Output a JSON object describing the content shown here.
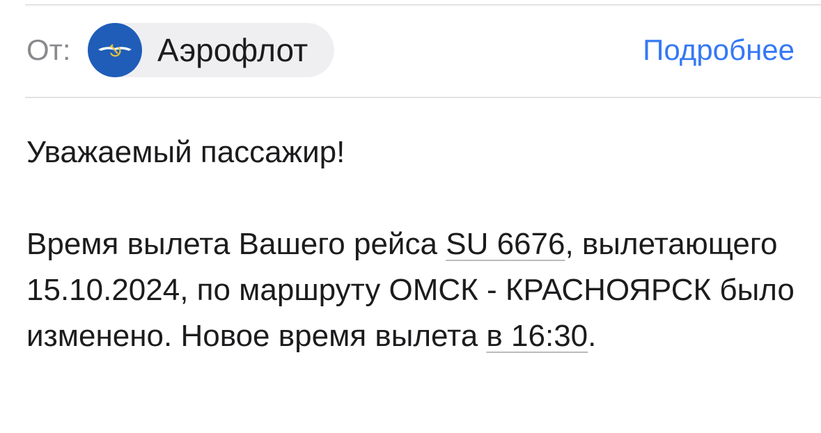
{
  "header": {
    "from_label": "От:",
    "sender": {
      "name": "Аэрофлот",
      "avatar_icon": "aeroflot-logo-icon",
      "avatar_color": "#1f5db8"
    },
    "details_link": "Подробнее",
    "link_color": "#3478f6"
  },
  "message": {
    "greeting": "Уважаемый пассажир!",
    "part1": "Время вылета Вашего рейса ",
    "flight_number": "SU 6676",
    "part2": ", вылетающего 15.10.2024, по маршруту ОМСК - КРАСНОЯРСК было изменено. Новое время вылета ",
    "new_time": "в 16:30",
    "part3": "."
  }
}
